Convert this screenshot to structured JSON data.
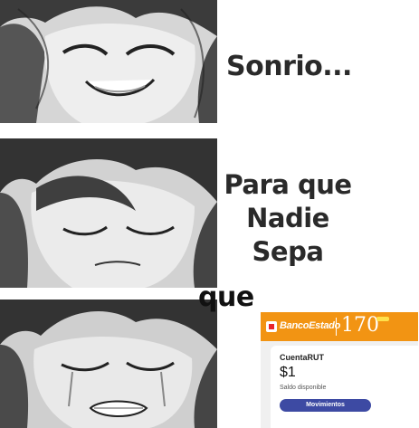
{
  "captions": {
    "line1": "Sonrio...",
    "line2": [
      "Para que",
      "Nadie",
      "Sepa"
    ],
    "line3": "que"
  },
  "bank_card": {
    "brand": "BancoEstado",
    "anniversary": "170",
    "account_name": "CuentaRUT",
    "balance": "$1",
    "balance_label": "Saldo disponible",
    "button_label": "Movimientos",
    "colors": {
      "header": "#f29413",
      "button": "#3d4aa3",
      "logo": "#e9252b"
    }
  },
  "panels": [
    "smiling-face",
    "sad-face",
    "crying-face"
  ]
}
